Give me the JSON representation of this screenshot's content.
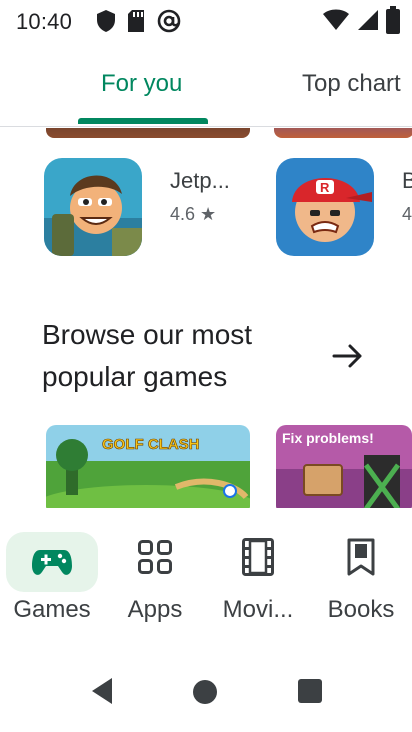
{
  "status_bar": {
    "time": "10:40",
    "left_icons": [
      "shield-icon",
      "sd-card-icon",
      "at-sign-icon"
    ],
    "right_icons": [
      "wifi-icon",
      "signal-icon",
      "battery-icon"
    ]
  },
  "top_tabs": [
    {
      "label": "For you",
      "selected": true
    },
    {
      "label": "Top chart",
      "selected": false
    }
  ],
  "apps": [
    {
      "name": "Jetp...",
      "rating": "4.6 ★",
      "icon": "jetpack-game-icon"
    },
    {
      "name": "",
      "rating": "",
      "icon": "baseball-game-icon"
    },
    {
      "name": "B",
      "rating": "4",
      "icon": ""
    }
  ],
  "browse": {
    "title": "Browse our most popular games",
    "arrow_icon": "arrow-right-icon"
  },
  "banners": [
    {
      "text": "GOLF CLASH",
      "icon": "golf-clash-banner"
    },
    {
      "text": "Fix problems!",
      "icon": "fix-problems-banner"
    }
  ],
  "bottom_nav": [
    {
      "label": "Games",
      "icon": "gamepad-icon",
      "selected": true
    },
    {
      "label": "Apps",
      "icon": "apps-grid-icon",
      "selected": false
    },
    {
      "label": "Movi...",
      "icon": "movie-film-icon",
      "selected": false
    },
    {
      "label": "Books",
      "icon": "bookmark-icon",
      "selected": false
    }
  ],
  "colors": {
    "accent": "#01875f",
    "selected_pill": "#e6f4ea",
    "text_primary": "#202124",
    "text_secondary": "#5f6368"
  }
}
